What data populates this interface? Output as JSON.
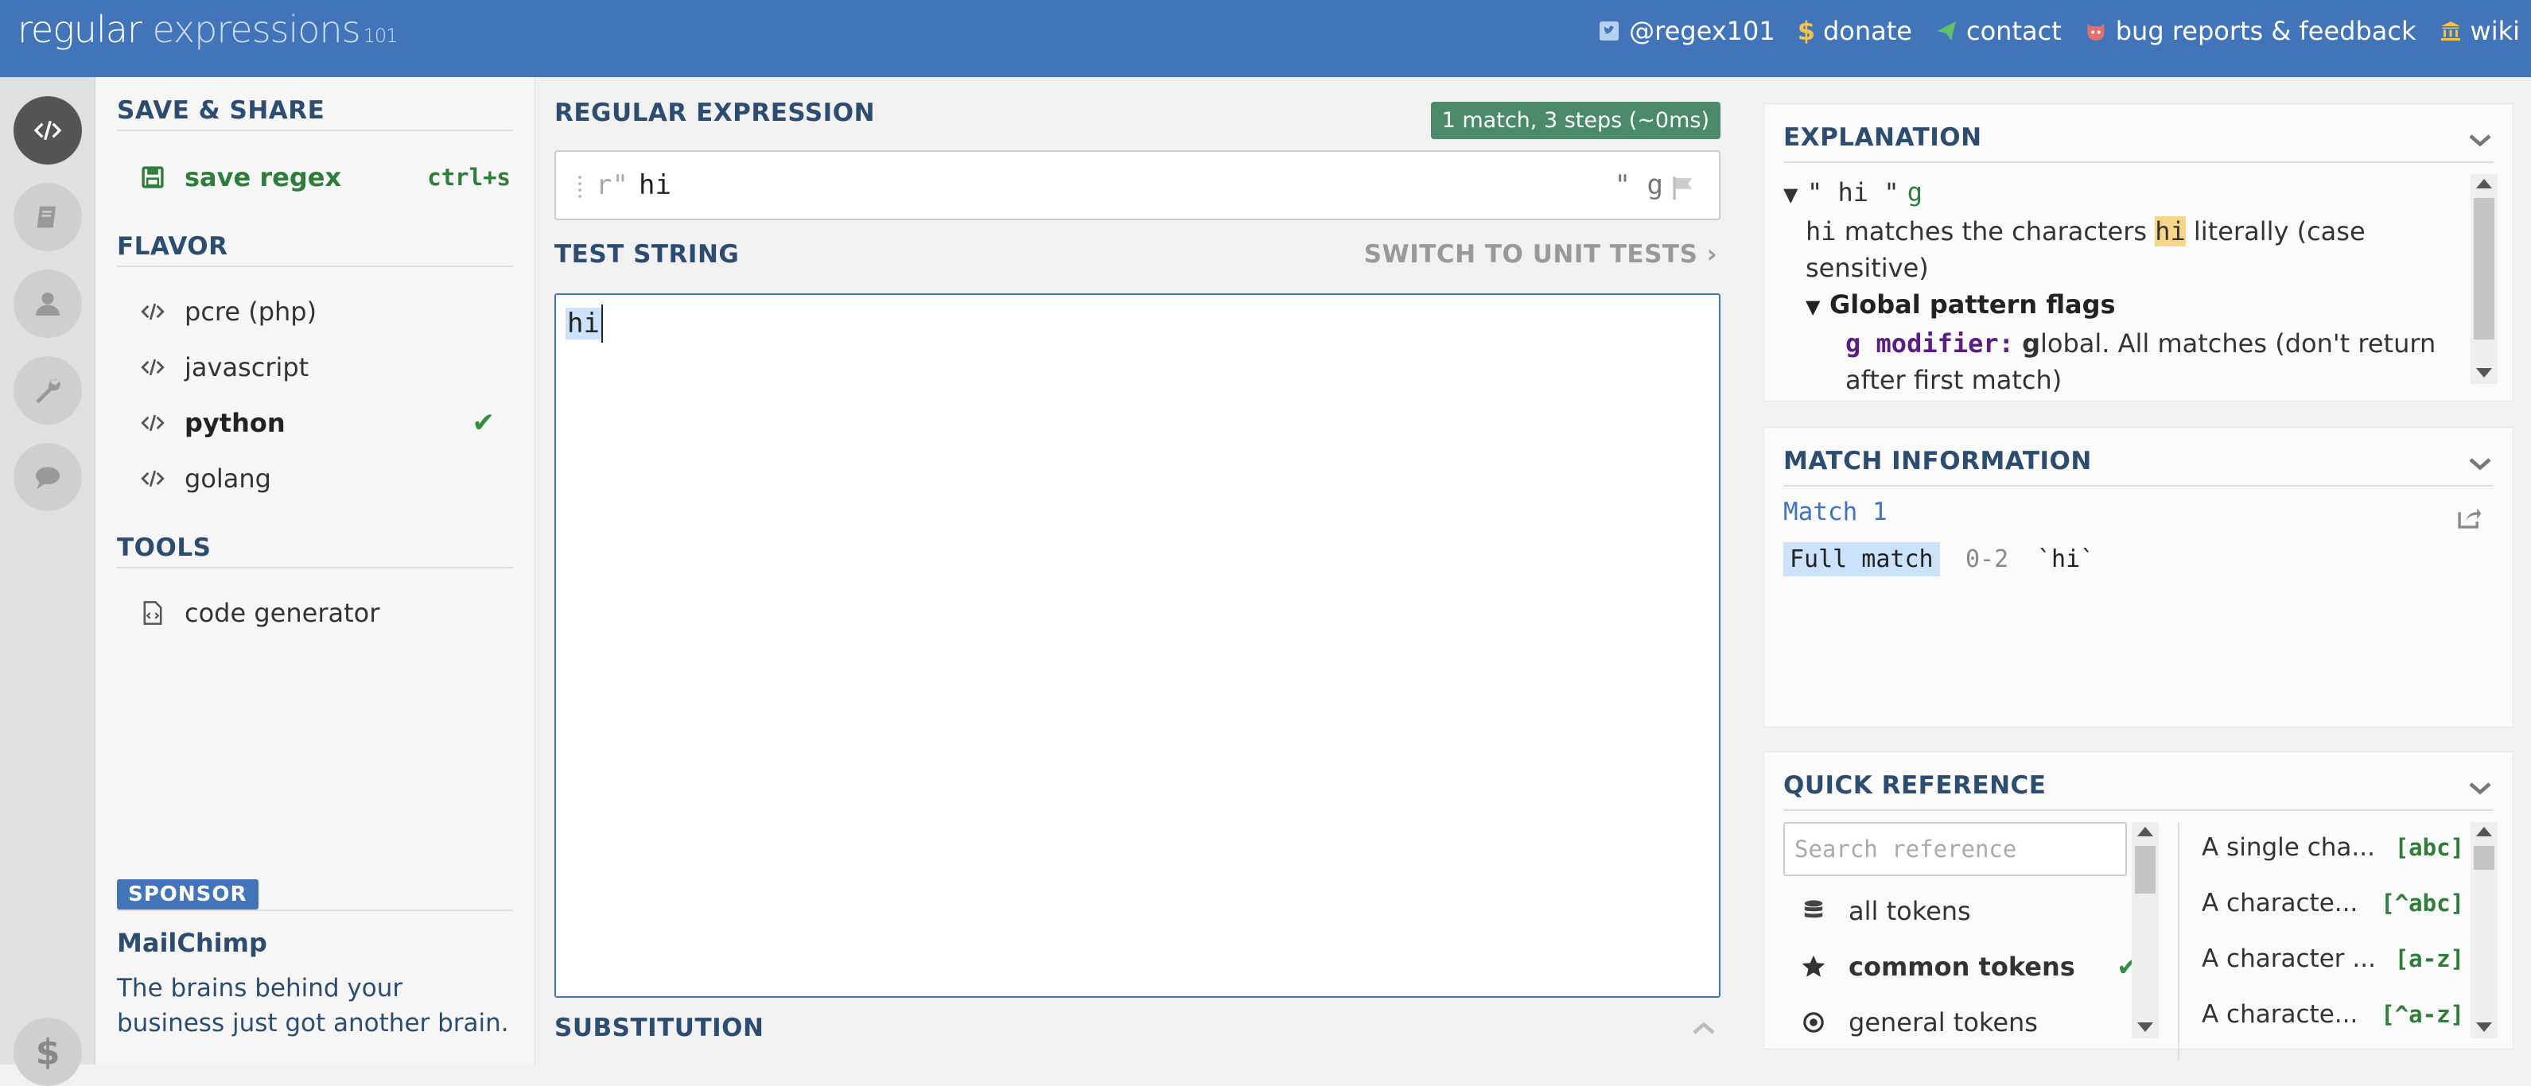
{
  "header": {
    "logo_main": "regular",
    "logo_sub": "expressions",
    "logo_version": "101",
    "links": [
      {
        "label": "@regex101",
        "icon": "twitter-icon"
      },
      {
        "label": "donate",
        "icon": "dollar-icon"
      },
      {
        "label": "contact",
        "icon": "paper-plane-icon"
      },
      {
        "label": "bug reports & feedback",
        "icon": "github-icon"
      },
      {
        "label": "wiki",
        "icon": "bank-icon"
      }
    ]
  },
  "rail": [
    "code-icon",
    "book-icon",
    "user-icon",
    "wrench-icon",
    "chat-icon"
  ],
  "sidebar": {
    "save_title": "SAVE & SHARE",
    "save_label": "save regex",
    "save_shortcut": "ctrl+s",
    "flavor_title": "FLAVOR",
    "flavors": [
      "pcre (php)",
      "javascript",
      "python",
      "golang"
    ],
    "selected_flavor": "python",
    "tools_title": "TOOLS",
    "tools": [
      "code generator"
    ],
    "sponsor_badge": "SPONSOR",
    "sponsor_name": "MailChimp",
    "sponsor_text": "The brains behind your business just got another brain."
  },
  "editor": {
    "regex_title": "REGULAR EXPRESSION",
    "match_badge": "1 match, 3 steps (~0ms)",
    "regex_prefix": "r\"",
    "regex_value": "hi",
    "regex_suffix": "\" g",
    "test_title": "TEST STRING",
    "unit_tests_label": "SWITCH TO UNIT TESTS",
    "test_value": "hi",
    "subst_title": "SUBSTITUTION"
  },
  "explanation": {
    "title": "EXPLANATION",
    "root_open": "\" hi \"",
    "root_flag": "g",
    "token": "hi",
    "text_before": " matches the characters ",
    "text_hl": "hi",
    "text_after": " literally (case sensitive)",
    "flags_title": "Global pattern flags",
    "mod_code": "g modifier:",
    "mod_letter": "g",
    "mod_text": "lobal. All matches (don't return after first match)"
  },
  "match_info": {
    "title": "MATCH INFORMATION",
    "match_label": "Match 1",
    "full_match": "Full match",
    "range": "0-2",
    "value": "`hi`"
  },
  "quick_ref": {
    "title": "QUICK REFERENCE",
    "search_placeholder": "Search reference",
    "categories": [
      {
        "label": "all tokens",
        "icon": "database-icon",
        "selected": false
      },
      {
        "label": "common tokens",
        "icon": "star-icon",
        "selected": true
      },
      {
        "label": "general tokens",
        "icon": "target-icon",
        "selected": false
      }
    ],
    "items": [
      {
        "desc": "A single cha...",
        "code": "[abc]"
      },
      {
        "desc": "A characte...",
        "code": "[^abc]"
      },
      {
        "desc": "A character ...",
        "code": "[a-z]"
      },
      {
        "desc": "A characte...",
        "code": "[^a-z]"
      }
    ]
  },
  "colors": {
    "header": "#4174b8",
    "accent_green": "#2f7d3a",
    "badge_green": "#4a8a6a",
    "highlight": "#f8d689"
  }
}
